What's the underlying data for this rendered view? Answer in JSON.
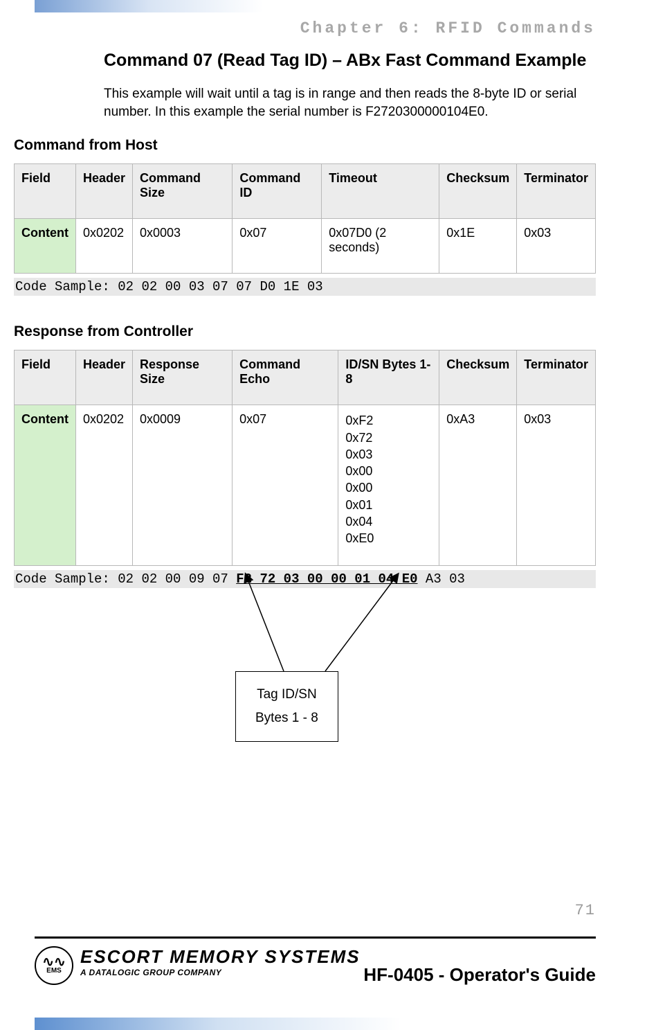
{
  "chapter_header": "Chapter 6: RFID Commands",
  "section_title": "Command 07 (Read Tag ID) – ABx Fast Command Example",
  "intro_text": "This example will wait until a tag is in range and then reads the 8-byte ID or serial number. In this example the serial number is F2720300000104E0.",
  "host_section": {
    "title": "Command from Host",
    "cols": [
      "Field",
      "Header",
      "Command Size",
      "Command ID",
      "Timeout",
      "Checksum",
      "Terminator"
    ],
    "row_label": "Content",
    "row": [
      "0x0202",
      "0x0003",
      "0x07",
      "0x07D0 (2 seconds)",
      "0x1E",
      "0x03"
    ],
    "code_prefix": "Code Sample: ",
    "code": "02 02 00 03 07 07 D0 1E 03"
  },
  "controller_section": {
    "title": "Response from Controller",
    "cols": [
      "Field",
      "Header",
      "Response Size",
      "Command Echo",
      "ID/SN Bytes 1-8",
      "Checksum",
      "Terminator"
    ],
    "row_label": "Content",
    "row": [
      "0x0202",
      "0x0009",
      "0x07",
      "0xF2\n0x72\n0x03\n0x00\n0x00\n0x01\n0x04\n0xE0",
      "0xA3",
      "0x03"
    ],
    "code_prefix": "Code Sample: ",
    "code_before": "02 02 00 09 07 ",
    "code_highlight": "F2 72 03 00 00 01 04 E0",
    "code_after": " A3 03"
  },
  "diagram": {
    "line1": "Tag ID/SN",
    "line2": "Bytes 1 - 8"
  },
  "page_number": "71",
  "footer": {
    "logo_top": "ESCORT MEMORY SYSTEMS",
    "logo_sub": "A DATALOGIC GROUP COMPANY",
    "ems_abbr": "EMS",
    "guide": "HF-0405 - Operator's Guide"
  }
}
